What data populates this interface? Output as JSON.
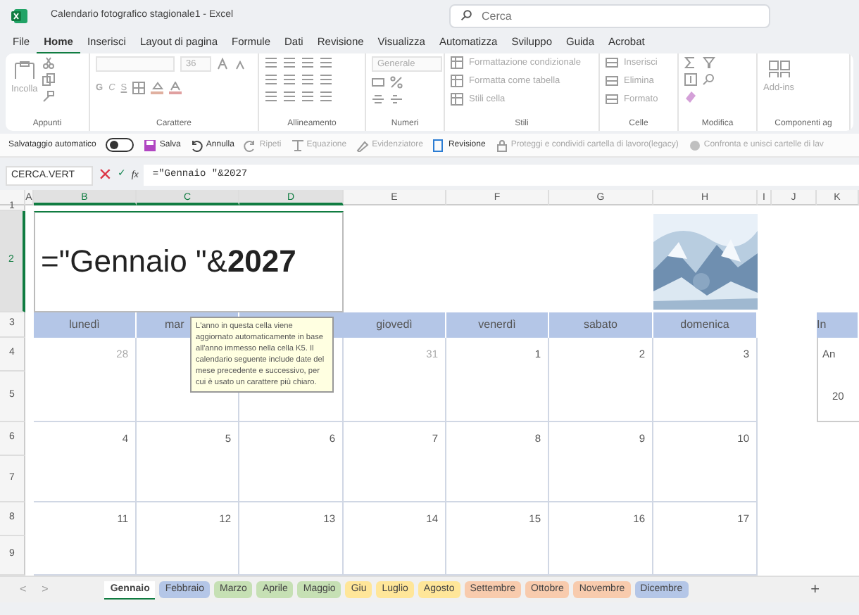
{
  "title_bar": {
    "title": "Calendario fotografico stagionale1  -  Excel",
    "search": {
      "placeholder": "Cerca"
    }
  },
  "menu_tabs": [
    {
      "label": "File",
      "selected": false
    },
    {
      "label": "Home",
      "selected": true
    },
    {
      "label": "Inserisci",
      "selected": false
    },
    {
      "label": "Layout di pagina",
      "selected": false
    },
    {
      "label": "Formule",
      "selected": false
    },
    {
      "label": "Dati",
      "selected": false
    },
    {
      "label": "Revisione",
      "selected": false
    },
    {
      "label": "Visualizza",
      "selected": false
    },
    {
      "label": "Automatizza",
      "selected": false
    },
    {
      "label": "Sviluppo",
      "selected": false
    },
    {
      "label": "Guida",
      "selected": false
    },
    {
      "label": "Acrobat",
      "selected": false
    }
  ],
  "ribbon": {
    "groups": [
      {
        "label": "Appunti",
        "texts": [
          "Incolla"
        ]
      },
      {
        "label": "Carattere",
        "texts": [
          "36",
          "G",
          "C",
          "S"
        ]
      },
      {
        "label": "Allineamento"
      },
      {
        "label": "Numeri",
        "texts": [
          "Generale"
        ]
      },
      {
        "label": "Stili",
        "texts": [
          "Formattazione condizionale",
          "Formatta come tabella",
          "Stili cella"
        ]
      },
      {
        "label": "Celle",
        "texts": [
          "Inserisci",
          "Elimina",
          "Formato"
        ]
      },
      {
        "label": "Modifica"
      },
      {
        "label": "Componenti ag",
        "texts": [
          "Add-ins"
        ]
      }
    ]
  },
  "quick_toolbar": [
    {
      "kind": "label",
      "label": "Salvataggio automatico"
    },
    {
      "kind": "toggle",
      "on": false
    },
    {
      "kind": "button",
      "label": "Salva",
      "disabled": false
    },
    {
      "kind": "button",
      "label": "Annulla",
      "disabled": false
    },
    {
      "kind": "button",
      "label": "Ripeti",
      "disabled": true
    },
    {
      "kind": "button",
      "label": "Equazione",
      "disabled": true
    },
    {
      "kind": "button",
      "label": "Evidenziatore",
      "disabled": true
    },
    {
      "kind": "button",
      "label": "Revisione",
      "disabled": false
    },
    {
      "kind": "button",
      "label": "Proteggi e condividi cartella di lavoro(legacy)",
      "disabled": true
    },
    {
      "kind": "button",
      "label": "Confronta e unisci cartelle di lav",
      "disabled": true
    }
  ],
  "formula_bar": {
    "name_box": "CERCA.VERT",
    "cancel": "×",
    "enter": "✓",
    "fx": "fx",
    "formula": "=\"Gennaio \"&2027"
  },
  "columns": [
    {
      "label": "A",
      "selected": false
    },
    {
      "label": "B",
      "selected": true
    },
    {
      "label": "C",
      "selected": true
    },
    {
      "label": "D",
      "selected": true
    },
    {
      "label": "E",
      "selected": false
    },
    {
      "label": "F",
      "selected": false
    },
    {
      "label": "G",
      "selected": false
    },
    {
      "label": "H",
      "selected": false
    },
    {
      "label": "I",
      "selected": false
    },
    {
      "label": "J",
      "selected": false
    },
    {
      "label": "K",
      "selected": false
    }
  ],
  "rows": [
    {
      "label": "1",
      "selected": false
    },
    {
      "label": "2",
      "selected": true
    },
    {
      "label": "3",
      "selected": false
    },
    {
      "label": "4",
      "selected": false
    },
    {
      "label": "5",
      "selected": false
    },
    {
      "label": "6",
      "selected": false
    },
    {
      "label": "7",
      "selected": false
    },
    {
      "label": "8",
      "selected": false
    },
    {
      "label": "9",
      "selected": false
    }
  ],
  "editing_cell": "=\"Gennaio \"&**2027**",
  "header_picture": {
    "kind": "picture"
  },
  "weekdays": [
    "lunedì",
    "mar",
    "giovedì",
    "venerdì",
    "sabato",
    "domenica"
  ],
  "weeks": [
    [
      {
        "day": "28",
        "faded": true
      },
      {
        "day": "31",
        "faded": true
      },
      {
        "day": "1",
        "faded": false
      },
      {
        "day": "2",
        "faded": false
      },
      {
        "day": "3",
        "faded": false
      }
    ],
    [
      {
        "day": "4",
        "faded": false
      },
      {
        "day": "5",
        "faded": false
      },
      {
        "day": "6",
        "faded": false
      },
      {
        "day": "7",
        "faded": false
      },
      {
        "day": "8",
        "faded": false
      },
      {
        "day": "9",
        "faded": false
      },
      {
        "day": "10",
        "faded": false
      }
    ],
    [
      {
        "day": "11",
        "faded": false
      },
      {
        "day": "12",
        "faded": false
      },
      {
        "day": "13",
        "faded": false
      },
      {
        "day": "14",
        "faded": false
      },
      {
        "day": "15",
        "faded": false
      },
      {
        "day": "16",
        "faded": false
      },
      {
        "day": "17",
        "faded": false
      }
    ]
  ],
  "side_table": {
    "header": "In",
    "row_1": "An",
    "row_2": "20"
  },
  "tooltip": "L'anno in questa cella viene aggiornato automaticamente in base all'anno immesso nella cella K5. Il calendario seguente include date del mese precedente e successivo, per cui è usato un carattere più chiaro.",
  "sheet_tabs": [
    {
      "label": "Gennaio",
      "selected": true,
      "color": "#ffffff"
    },
    {
      "label": "Febbraio",
      "selected": false,
      "color": "#b4c6e7"
    },
    {
      "label": "Marzo",
      "selected": false,
      "color": "#c6e0b4"
    },
    {
      "label": "Aprile",
      "selected": false,
      "color": "#c6e0b4"
    },
    {
      "label": "Maggio",
      "selected": false,
      "color": "#c6e0b4"
    },
    {
      "label": "Giu",
      "selected": false,
      "color": "#ffe699"
    },
    {
      "label": "Luglio",
      "selected": false,
      "color": "#ffe699"
    },
    {
      "label": "Agosto",
      "selected": false,
      "color": "#ffe699"
    },
    {
      "label": "Settembre",
      "selected": false,
      "color": "#f8cbad"
    },
    {
      "label": "Ottobre",
      "selected": false,
      "color": "#f8cbad"
    },
    {
      "label": "Novembre",
      "selected": false,
      "color": "#f8cbad"
    },
    {
      "label": "Dicembre",
      "selected": false,
      "color": "#b4c6e7"
    }
  ],
  "sheet_nav": {
    "prev": "<",
    "next": ">",
    "add": "+"
  }
}
